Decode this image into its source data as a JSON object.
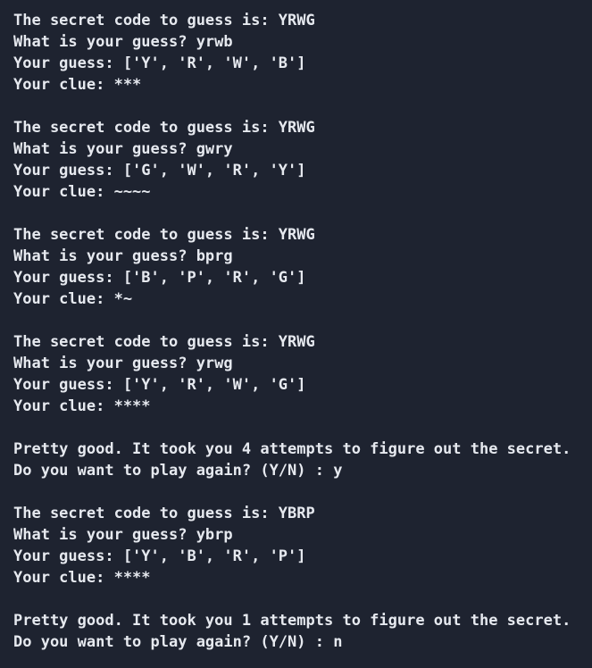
{
  "terminal": {
    "lines": [
      "The secret code to guess is: YRWG",
      "What is your guess? yrwb",
      "Your guess: ['Y', 'R', 'W', 'B']",
      "Your clue: ***",
      "",
      "The secret code to guess is: YRWG",
      "What is your guess? gwry",
      "Your guess: ['G', 'W', 'R', 'Y']",
      "Your clue: ~~~~",
      "",
      "The secret code to guess is: YRWG",
      "What is your guess? bprg",
      "Your guess: ['B', 'P', 'R', 'G']",
      "Your clue: *~",
      "",
      "The secret code to guess is: YRWG",
      "What is your guess? yrwg",
      "Your guess: ['Y', 'R', 'W', 'G']",
      "Your clue: ****",
      "",
      "Pretty good. It took you 4 attempts to figure out the secret.",
      "Do you want to play again? (Y/N) : y",
      "",
      "The secret code to guess is: YBRP",
      "What is your guess? ybrp",
      "Your guess: ['Y', 'B', 'R', 'P']",
      "Your clue: ****",
      "",
      "Pretty good. It took you 1 attempts to figure out the secret.",
      "Do you want to play again? (Y/N) : n"
    ]
  }
}
